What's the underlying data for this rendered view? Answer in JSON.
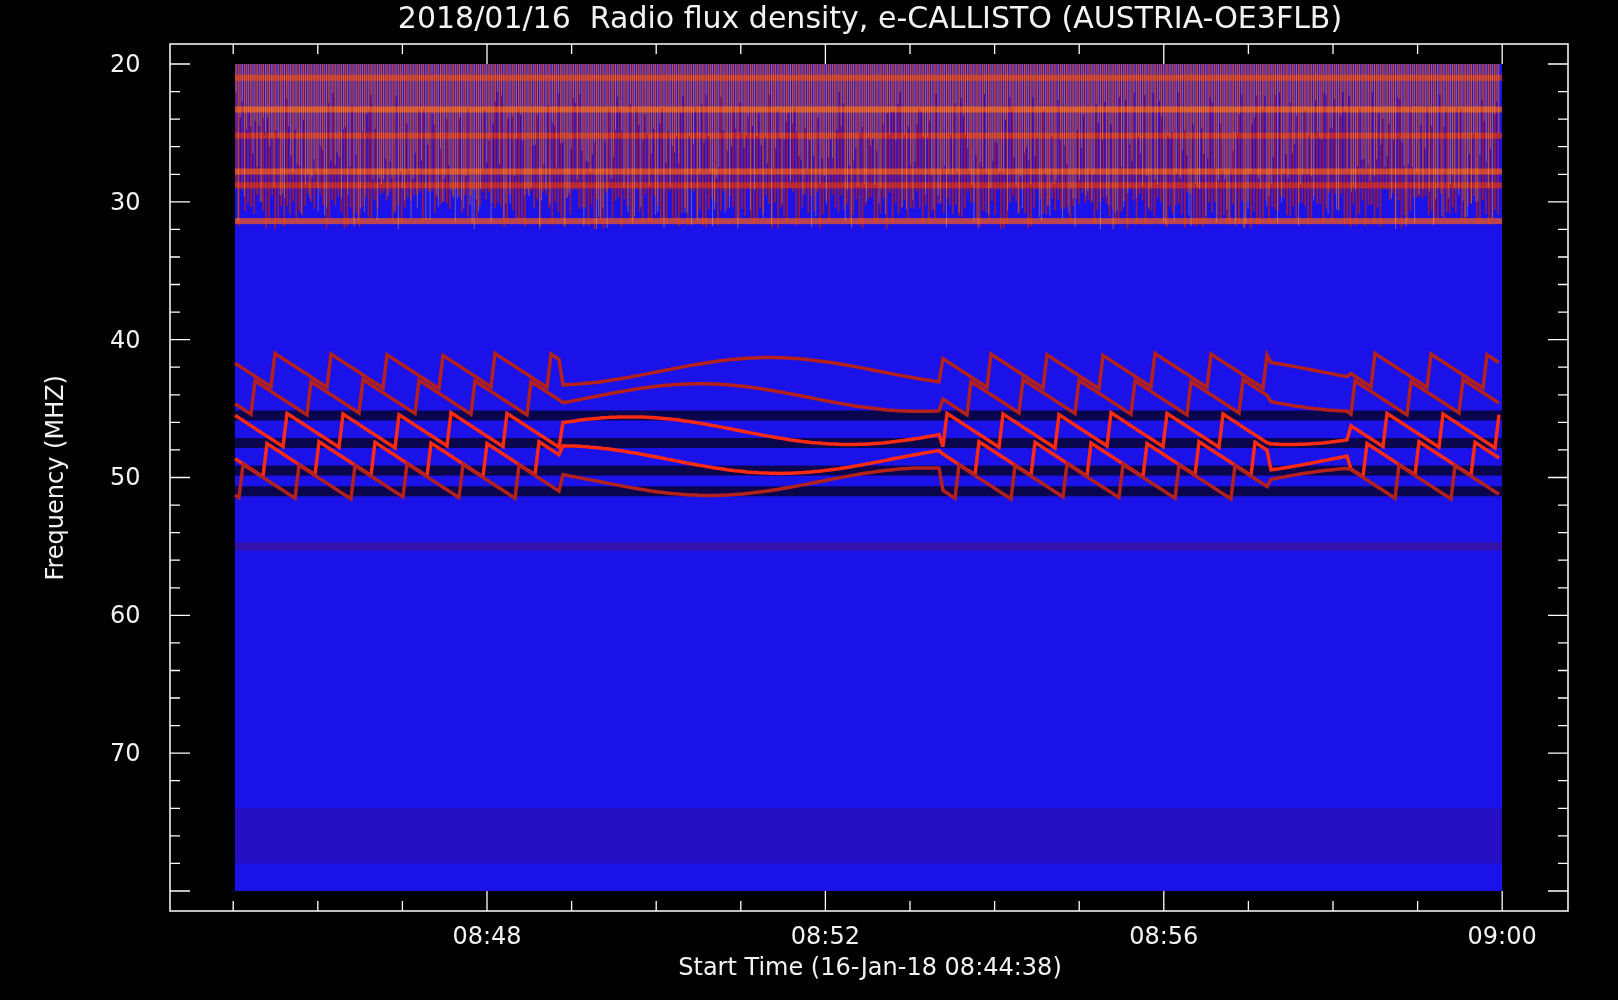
{
  "title": "2018/01/16  Radio flux density, e-CALLISTO (AUSTRIA-OE3FLB)",
  "ylabel": "Frequency (MHZ)",
  "xlabel": "Start Time (16-Jan-18 08:44:38)",
  "yticks": [
    "20",
    "30",
    "40",
    "50",
    "60",
    "70"
  ],
  "xticks": [
    "08:48",
    "08:52",
    "08:56",
    "09:00"
  ]
}
